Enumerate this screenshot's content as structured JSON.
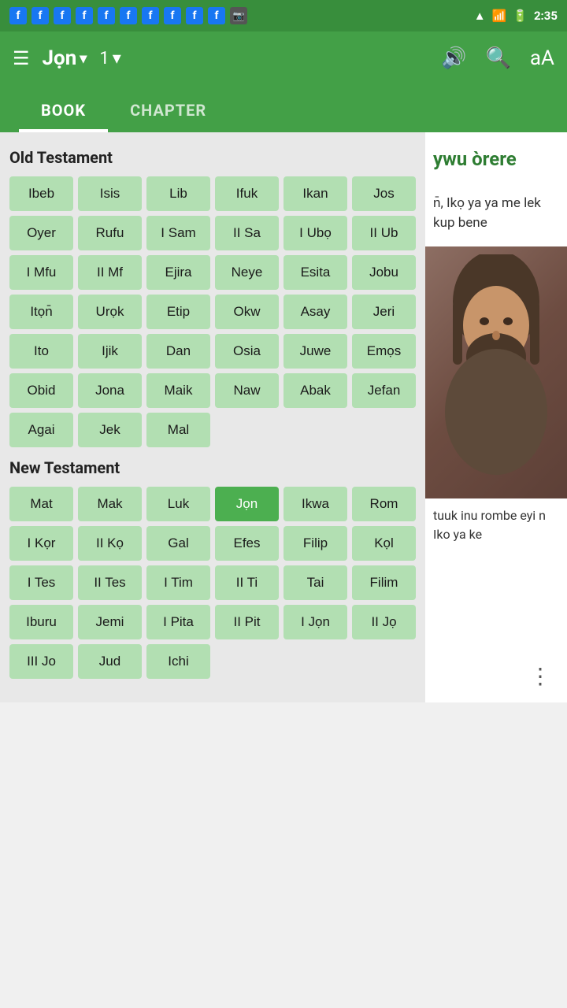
{
  "statusBar": {
    "time": "2:35",
    "fbCount": 10
  },
  "topNav": {
    "menuLabel": "☰",
    "bookTitle": "Jọn",
    "chapterNum": "1",
    "dropdownArrow": "▾",
    "volumeIcon": "🔊",
    "searchIcon": "🔍",
    "fontIcon": "aA"
  },
  "tabs": [
    {
      "id": "book",
      "label": "BOOK"
    },
    {
      "id": "chapter",
      "label": "CHAPTER"
    }
  ],
  "activeTab": "book",
  "oldTestament": {
    "title": "Old Testament",
    "books": [
      "Ibeb",
      "Isis",
      "Lib",
      "Ifuk",
      "Ikan",
      "Jos",
      "Oyer",
      "Rufu",
      "I Sam",
      "II Sa",
      "I Ubọ",
      "II Ub",
      "I Mfu",
      "II Mf",
      "Ejira",
      "Neye",
      "Esita",
      "Jobu",
      "Itọn̄",
      "Urọk",
      "Etip",
      "Okw",
      "Asay",
      "Jeri",
      "Ito",
      "Ijik",
      "Dan",
      "Osia",
      "Juwe",
      "Emọs",
      "Obid",
      "Jona",
      "Maik",
      "Naw",
      "Abak",
      "Jefan",
      "Agai",
      "Jek",
      "Mal"
    ]
  },
  "newTestament": {
    "title": "New Testament",
    "books": [
      "Mat",
      "Mak",
      "Luk",
      "Jọn",
      "Ikwa",
      "Rom",
      "I Kọr",
      "II Kọ",
      "Gal",
      "Efes",
      "Filip",
      "Kọl",
      "I Tes",
      "II Tes",
      "I Tim",
      "II Ti",
      "Tai",
      "Filim",
      "Iburu",
      "Jemi",
      "I Pita",
      "II Pit",
      "I Jọn",
      "II Jọ",
      "III Jo",
      "Jud",
      "Ichi"
    ]
  },
  "bibleText": {
    "highlightWord": "ywu òrere",
    "paragraph1": "n̄, Ikọ ya ya me lek kup bene",
    "paragraph2": "tuuk inu rombe eyi n Iko ya ke"
  },
  "activeBook": "Jọn",
  "moreOptions": "⋮"
}
